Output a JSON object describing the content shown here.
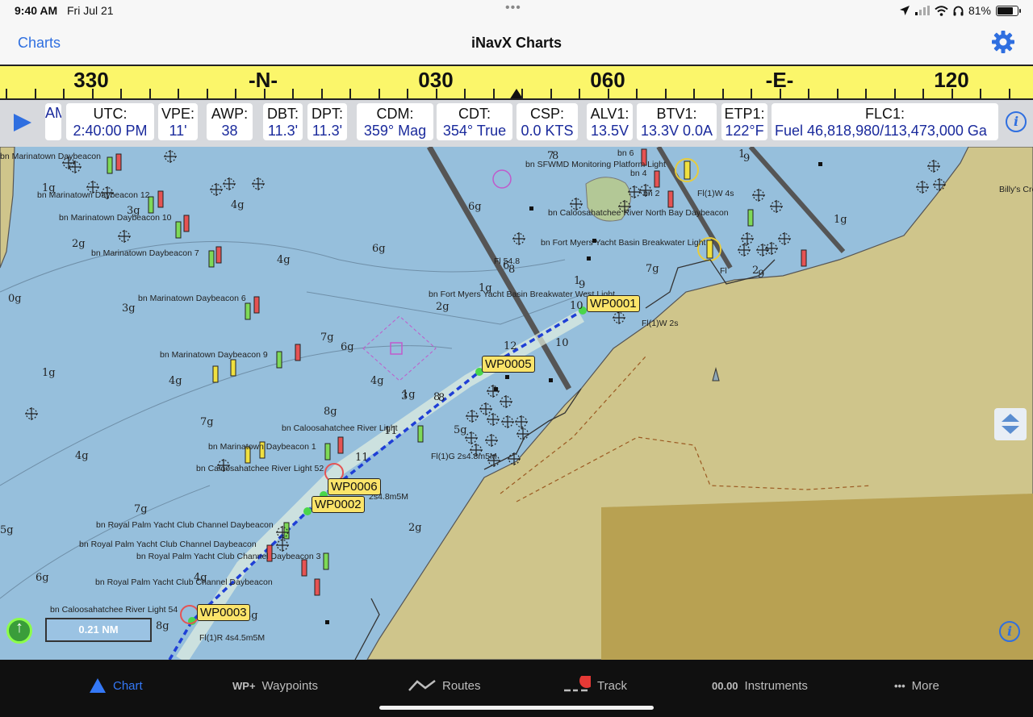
{
  "status": {
    "time": "9:40 AM",
    "date": "Fri Jul 21",
    "battery": "81%",
    "battery_level": 0.81
  },
  "nav": {
    "back_label": "Charts",
    "title": "iNavX Charts",
    "settings_icon": "gear-icon"
  },
  "compass": {
    "labels": [
      "330",
      "-N-",
      "030",
      "060",
      "-E-",
      "120"
    ]
  },
  "instruments": [
    {
      "key": "",
      "value": "AM"
    },
    {
      "key": "UTC:",
      "value": "2:40:00 PM"
    },
    {
      "key": "VPE:",
      "value": "11'"
    },
    {
      "key": "AWP:",
      "value": "38"
    },
    {
      "key": "DBT:",
      "value": "11.3'"
    },
    {
      "key": "DPT:",
      "value": "11.3'"
    },
    {
      "key": "CDM:",
      "value": "359° Mag"
    },
    {
      "key": "CDT:",
      "value": "354° True"
    },
    {
      "key": "CSP:",
      "value": "0.0 KTS"
    },
    {
      "key": "ALV1:",
      "value": "13.5V"
    },
    {
      "key": "BTV1:",
      "value": "13.3V 0.0A"
    },
    {
      "key": "ETP1:",
      "value": "122°F"
    },
    {
      "key": "FLC1:",
      "value": "Fuel 46,818,980/113,473,000 Ga"
    }
  ],
  "chart": {
    "waypoints": [
      "WP0001",
      "WP0005",
      "WP0006",
      "WP0002",
      "WP0003"
    ],
    "scale": "0.21 NM",
    "soundings": [
      "1g",
      "3g",
      "4g",
      "2g",
      "4g",
      "0g",
      "3g",
      "6g",
      "1g",
      "4g",
      "7g",
      "6g",
      "4g",
      "7g",
      "4g",
      "8g",
      "1g",
      "5g",
      "7g",
      "5g",
      "2g",
      "6g",
      "4g",
      "8g",
      "1g",
      "6g",
      "7g",
      "1g",
      "2g",
      "10",
      "12",
      "10",
      "3",
      "8",
      "8",
      "11",
      "11",
      "7",
      "8",
      "2",
      "9",
      "6",
      "8",
      "1",
      "9",
      "1",
      "9",
      "3g"
    ],
    "labels": [
      "bn Marinatown Daybeacon",
      "bn Marinatown Daybeacon 12",
      "bn Marinatown Daybeacon 10",
      "bn Marinatown Daybeacon 7",
      "bn Marinatown Daybeacon 6",
      "bn Marinatown Daybeacon 9",
      "bn Caloosahatchee River Light",
      "bn Marinatown Daybeacon 1",
      "bn Caloosahatchee River Light 52",
      "bn Royal Palm Yacht Club Channel Daybeacon",
      "bn Royal Palm Yacht Club Channel Daybeacon",
      "bn Royal Palm Yacht Club Channel Daybeacon 3",
      "bn Royal Palm Yacht Club Channel Daybeacon",
      "bn Caloosahatchee River Light 54",
      "bn SFWMD Monitoring Platform Light",
      "bn Caloosahatchee River North Bay Daybeacon",
      "bn Fort Myers Yacht Basin Breakwater Light",
      "bn Fort Myers Yacht Basin Breakwater West Light",
      "bn 6",
      "bn 4",
      "bn 2",
      "Fl(1)W 4s",
      "Fl(1)W 2s",
      "Fl 54.8",
      "Fl(1)G 2s4.8m5M",
      "2s4.8m5M",
      "Fl(1)R 4s4.5m5M",
      "Fl",
      "Billy's Cre"
    ]
  },
  "tabs": [
    {
      "label": "Chart",
      "icon": "chart-triangle-icon",
      "active": true
    },
    {
      "label": "Waypoints",
      "prefix": "WP+",
      "icon": "waypoint-add-icon"
    },
    {
      "label": "Routes",
      "icon": "routes-icon"
    },
    {
      "label": "Track",
      "icon": "track-record-icon"
    },
    {
      "label": "Instruments",
      "prefix": "00.00",
      "icon": "instruments-icon"
    },
    {
      "label": "More",
      "prefix": "•••",
      "icon": "more-icon"
    }
  ]
}
